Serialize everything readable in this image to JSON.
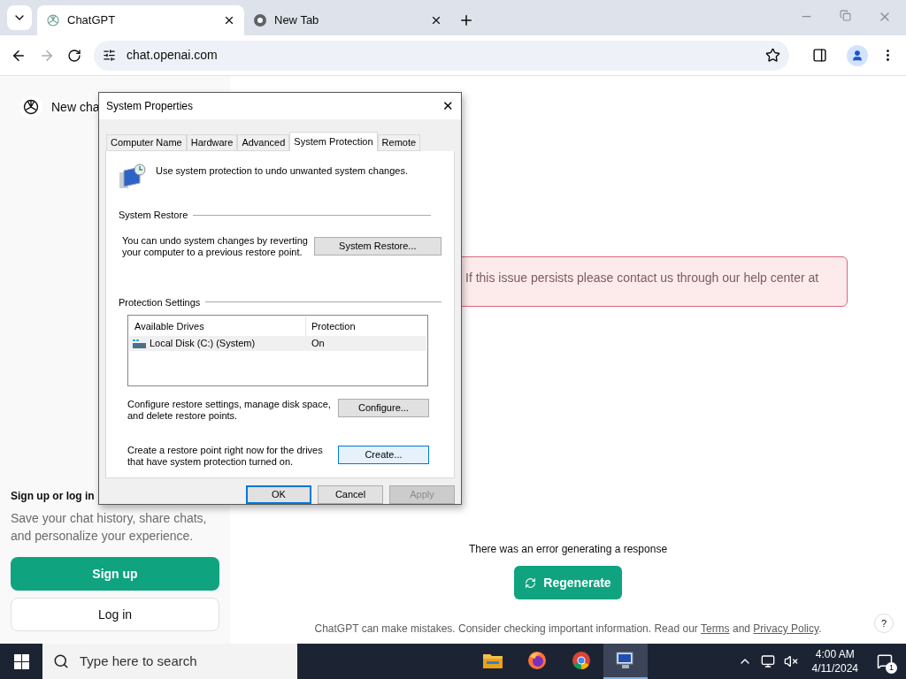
{
  "browser": {
    "tabs": [
      {
        "title": "ChatGPT",
        "selected": true
      },
      {
        "title": "New Tab",
        "selected": false
      }
    ],
    "url": "chat.openai.com"
  },
  "sidebar": {
    "new_chat": "New cha",
    "signup_title": "Sign up or log in",
    "signup_text": "Save your chat history, share chats, and personalize your experience.",
    "signup_button": "Sign up",
    "login_button": "Log in"
  },
  "main": {
    "error_box": "If this issue persists please contact us through our help center at",
    "error_message": "There was an error generating a response",
    "regenerate": "Regenerate",
    "footer": "ChatGPT can make mistakes. Consider checking important information. Read our ",
    "terms": "Terms",
    "and": " and ",
    "privacy": "Privacy Policy",
    "period": ".",
    "help": "?"
  },
  "dialog": {
    "title": "System Properties",
    "close": "✕",
    "tabs": [
      {
        "label": "Computer Name",
        "selected": false
      },
      {
        "label": "Hardware",
        "selected": false
      },
      {
        "label": "Advanced",
        "selected": false
      },
      {
        "label": "System Protection",
        "selected": true
      },
      {
        "label": "Remote",
        "selected": false
      }
    ],
    "intro": "Use system protection to undo unwanted system changes.",
    "restore_heading": "System Restore",
    "restore_text": "You can undo system changes by reverting your computer to a previous restore point.",
    "restore_button": "System Restore...",
    "protection_heading": "Protection Settings",
    "columns": [
      "Available Drives",
      "Protection"
    ],
    "drives": [
      {
        "name": "Local Disk (C:) (System)",
        "protection": "On",
        "selected": true
      }
    ],
    "configure_text": "Configure restore settings, manage disk space, and delete restore points.",
    "configure_button": "Configure...",
    "create_text": "Create a restore point right now for the drives that have system protection turned on.",
    "create_button": "Create...",
    "buttons": [
      {
        "label": "OK",
        "kind": "default",
        "disabled": false
      },
      {
        "label": "Cancel",
        "kind": "normal",
        "disabled": false
      },
      {
        "label": "Apply",
        "kind": "normal",
        "disabled": true
      }
    ]
  },
  "taskbar": {
    "search_placeholder": "Type here to search",
    "apps": [
      {
        "kind": "folder",
        "selected": false
      },
      {
        "kind": "firefox",
        "selected": false
      },
      {
        "kind": "chrome",
        "selected": false
      },
      {
        "kind": "system",
        "selected": true
      }
    ],
    "time": "4:00 AM",
    "date": "4/11/2024",
    "notifications": "1"
  }
}
